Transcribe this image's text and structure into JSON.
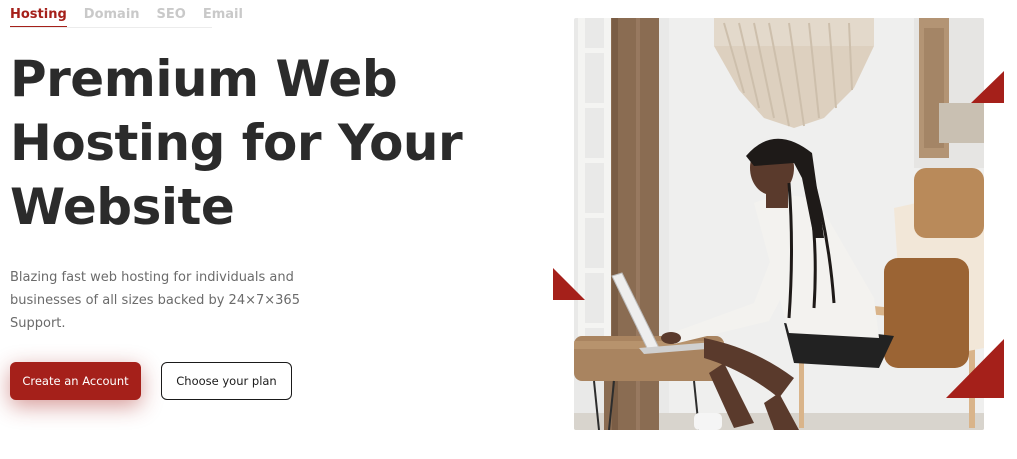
{
  "tabs": [
    {
      "label": "Hosting",
      "active": true
    },
    {
      "label": "Domain",
      "active": false
    },
    {
      "label": "SEO",
      "active": false
    },
    {
      "label": "Email",
      "active": false
    }
  ],
  "hero": {
    "title_line1": "Premium Web",
    "title_line2": "Hosting for Your",
    "title_line3": "Website",
    "subtitle_line1": "Blazing fast web hosting for individuals and",
    "subtitle_line2": "businesses of all sizes backed by 24×7×365 Support.",
    "primary_button": "Create an Account",
    "secondary_button": "Choose your plan"
  },
  "colors": {
    "accent": "#a5201a",
    "heading": "#2b2b2b",
    "muted_text": "#6b6b6b",
    "inactive_tab": "#c9c9c9"
  },
  "image": {
    "subject": "woman-using-laptop-photo",
    "decorations": [
      "triangle-accent",
      "triangle-accent",
      "triangle-accent"
    ]
  }
}
